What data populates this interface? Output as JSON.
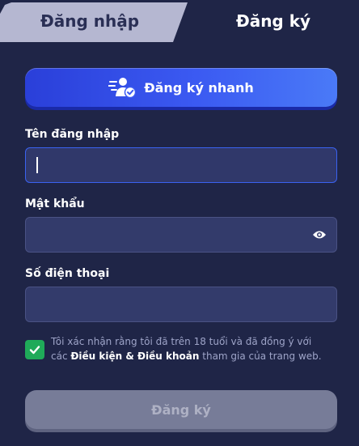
{
  "tabs": {
    "login": "Đăng nhập",
    "register": "Đăng ký"
  },
  "quick_register": {
    "label": "Đăng ký nhanh",
    "icon": "user-check-speed-icon"
  },
  "form": {
    "username": {
      "label": "Tên đăng nhập",
      "value": ""
    },
    "password": {
      "label": "Mật khẩu",
      "value": "",
      "icon": "eye-icon"
    },
    "phone": {
      "label": "Số điện thoại",
      "value": ""
    }
  },
  "terms": {
    "checked": true,
    "line1": "Tôi xác nhận rằng tôi đã trên 18 tuổi và đã đồng ý với",
    "prefix": "các ",
    "link": "Điều kiện & Điều khoản",
    "suffix": " tham gia của trang web."
  },
  "submit": {
    "label": "Đăng ký"
  },
  "colors": {
    "background": "#1f2547",
    "accent": "#3b5af2",
    "checkbox": "#1faa59",
    "disabled_button": "#777c98"
  }
}
